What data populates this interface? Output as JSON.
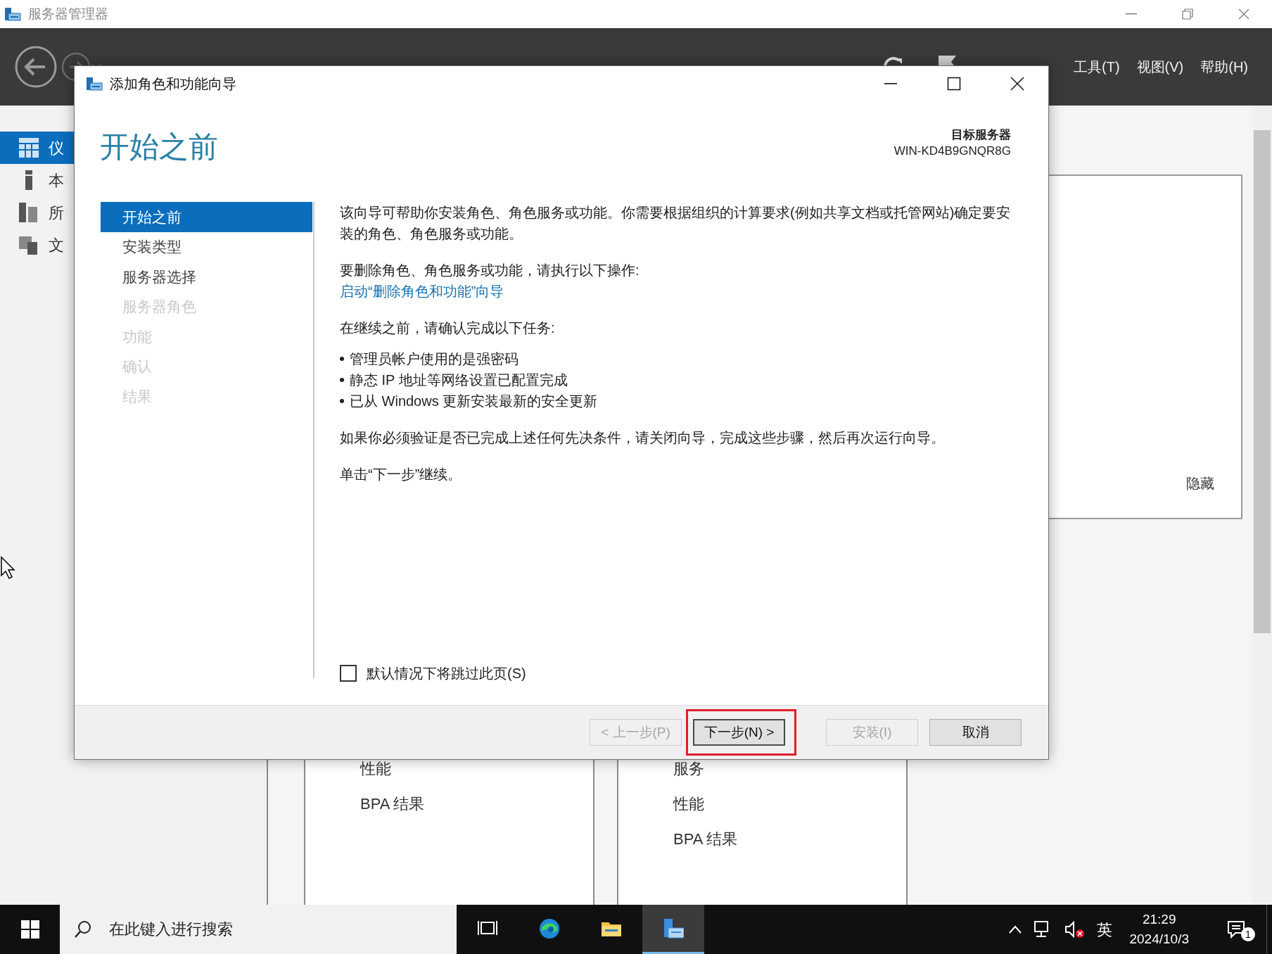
{
  "app_window": {
    "title": "服务器管理器",
    "menus": [
      "工具(T)",
      "视图(V)",
      "帮助(H)"
    ],
    "sidebar": {
      "items": [
        {
          "label": "仪",
          "kind": "dashboard",
          "selected": true
        },
        {
          "label": "本",
          "kind": "local",
          "selected": false
        },
        {
          "label": "所",
          "kind": "all",
          "selected": false
        },
        {
          "label": "文",
          "kind": "files",
          "selected": false
        }
      ]
    },
    "welcome_panel": {
      "hide_link": "隐藏"
    },
    "tiles": [
      {
        "items": [
          "性能",
          "BPA 结果"
        ]
      },
      {
        "items": [
          "服务",
          "性能",
          "BPA 结果"
        ]
      }
    ]
  },
  "dialog": {
    "title": "添加角色和功能向导",
    "heading": "开始之前",
    "target_label": "目标服务器",
    "target_server": "WIN-KD4B9GNQR8G",
    "steps": [
      {
        "label": "开始之前",
        "selected": true,
        "disabled": false
      },
      {
        "label": "安装类型",
        "selected": false,
        "disabled": false
      },
      {
        "label": "服务器选择",
        "selected": false,
        "disabled": false
      },
      {
        "label": "服务器角色",
        "selected": false,
        "disabled": true
      },
      {
        "label": "功能",
        "selected": false,
        "disabled": true
      },
      {
        "label": "确认",
        "selected": false,
        "disabled": true
      },
      {
        "label": "结果",
        "selected": false,
        "disabled": true
      }
    ],
    "content": [
      {
        "kind": "text",
        "text": "该向导可帮助你安装角色、角色服务或功能。你需要根据组织的计算要求(例如共享文档或托管网站)确定要安装的角色、角色服务或功能。"
      },
      {
        "kind": "text",
        "text": "要删除角色、角色服务或功能，请执行以下操作:"
      },
      {
        "kind": "link",
        "text": "启动“删除角色和功能”向导"
      },
      {
        "kind": "text",
        "text": "在继续之前，请确认完成以下任务:"
      },
      {
        "kind": "bullet",
        "text": "管理员帐户使用的是强密码"
      },
      {
        "kind": "bullet",
        "text": "静态 IP 地址等网络设置已配置完成"
      },
      {
        "kind": "bullet",
        "text": "已从 Windows 更新安装最新的安全更新"
      },
      {
        "kind": "text",
        "text": "如果你必须验证是否已完成上述任何先决条件，请关闭向导，完成这些步骤，然后再次运行向导。"
      },
      {
        "kind": "text",
        "text": "单击“下一步”继续。"
      }
    ],
    "skip_checkbox": {
      "label": "默认情况下将跳过此页(S)",
      "checked": false
    },
    "buttons": [
      {
        "label": "< 上一步(P)",
        "disabled": true,
        "highlighted": false
      },
      {
        "label": "下一步(N) >",
        "disabled": false,
        "highlighted": true
      },
      {
        "label": "安装(I)",
        "disabled": true,
        "highlighted": false
      },
      {
        "label": "取消",
        "disabled": false,
        "highlighted": false
      }
    ]
  },
  "taskbar": {
    "search_placeholder": "在此键入进行搜索",
    "apps": [
      {
        "kind": "taskview",
        "active": false
      },
      {
        "kind": "edge",
        "active": false
      },
      {
        "kind": "explorer",
        "active": false
      },
      {
        "kind": "servermanager",
        "active": true
      }
    ],
    "tray": {
      "ime": "英",
      "time": "21:29",
      "date": "2024/10/3",
      "notifications": "1"
    }
  }
}
